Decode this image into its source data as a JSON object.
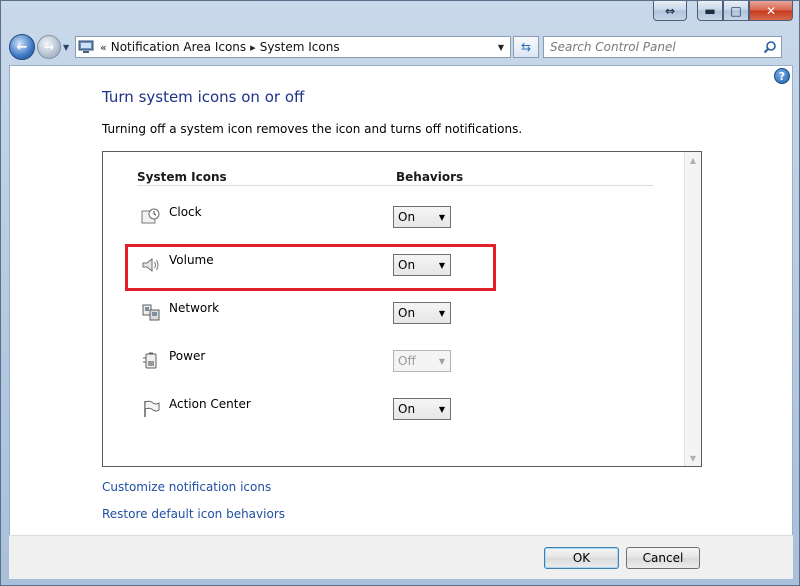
{
  "window": {
    "caption_buttons": [
      "resize-icon",
      "minimize-icon",
      "maximize-icon",
      "close-icon"
    ]
  },
  "navigation": {
    "back_icon": "back-arrow-icon",
    "forward_icon": "forward-arrow-icon",
    "breadcrumb": [
      "Notification Area Icons",
      "System Icons"
    ],
    "overflow_glyph": "«",
    "separator_glyph": "▸",
    "search_placeholder": "Search Control Panel"
  },
  "page": {
    "title": "Turn system icons on or off",
    "description": "Turning off a system icon removes the icon and turns off notifications.",
    "columns": {
      "icons": "System Icons",
      "behaviors": "Behaviors"
    },
    "rows": [
      {
        "label": "Clock",
        "icon": "clock-icon",
        "behavior": "On",
        "enabled": true
      },
      {
        "label": "Volume",
        "icon": "volume-icon",
        "behavior": "On",
        "enabled": true
      },
      {
        "label": "Network",
        "icon": "network-icon",
        "behavior": "On",
        "enabled": true
      },
      {
        "label": "Power",
        "icon": "power-icon",
        "behavior": "Off",
        "enabled": false
      },
      {
        "label": "Action Center",
        "icon": "flag-icon",
        "behavior": "On",
        "enabled": true
      }
    ],
    "links": {
      "customize": "Customize notification icons",
      "restore": "Restore default icon behaviors"
    }
  },
  "buttons": {
    "ok": "OK",
    "cancel": "Cancel"
  },
  "colors": {
    "title": "#1e3287",
    "link": "#1f4fa3",
    "highlight": "#e2202c"
  }
}
